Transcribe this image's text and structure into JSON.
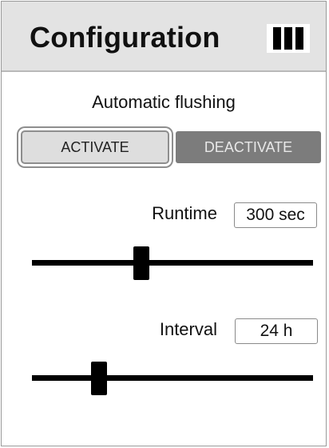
{
  "header": {
    "title": "Configuration",
    "menu_icon": "menu-bars-icon"
  },
  "flushing": {
    "title": "Automatic flushing",
    "activate_label": "ACTIVATE",
    "deactivate_label": "DEACTIVATE",
    "selected": "ACTIVATE"
  },
  "runtime": {
    "label": "Runtime",
    "value": "300 sec",
    "slider_fraction": 0.39
  },
  "interval": {
    "label": "Interval",
    "value": "24 h",
    "slider_fraction": 0.24
  },
  "colors": {
    "header_bg": "#e3e3e3",
    "active_button": "#dedede",
    "inactive_button": "#7c7c7c"
  }
}
